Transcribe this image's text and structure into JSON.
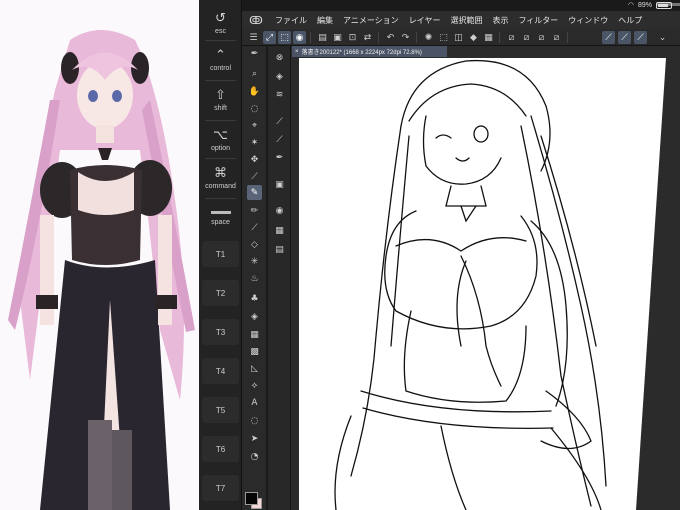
{
  "status": {
    "battery": "89%"
  },
  "menu": {
    "items": [
      "ファイル",
      "編集",
      "アニメーション",
      "レイヤー",
      "選択範囲",
      "表示",
      "フィルター",
      "ウィンドウ",
      "ヘルプ"
    ]
  },
  "keys": {
    "esc": "esc",
    "control": "control",
    "shift": "shift",
    "option": "option",
    "command": "command",
    "space": "space",
    "t1": "T1",
    "t2": "T2",
    "t3": "T3",
    "t4": "T4",
    "t5": "T5",
    "t6": "T6",
    "t7": "T7"
  },
  "document": {
    "tab_label": "落書き200122* (1668 x 2224px 72dpi 72.8%)"
  },
  "colors": {
    "main": "#050505",
    "sub": "#f3d7d7",
    "accent": "#4b5466"
  }
}
